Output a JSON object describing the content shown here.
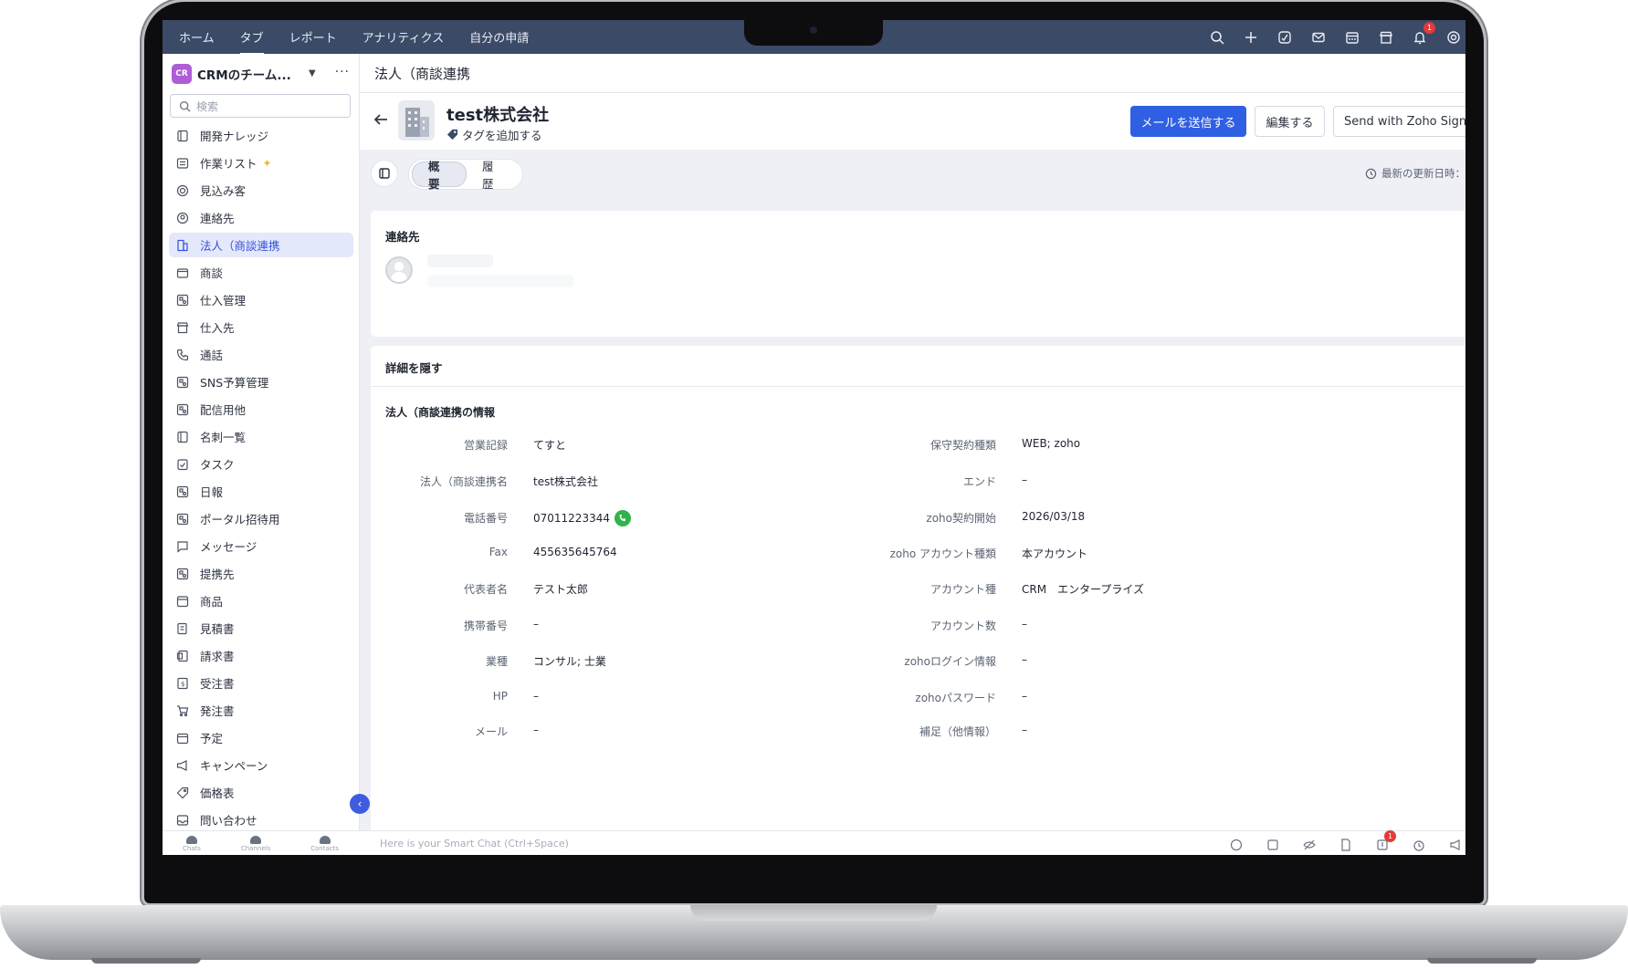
{
  "topnav": [
    "ホーム",
    "タブ",
    "レポート",
    "アナリティクス",
    "自分の申請"
  ],
  "notification_count": "1",
  "workspace": {
    "logo": "CR",
    "name": "CRMのチーム..."
  },
  "search": {
    "placeholder": "検索"
  },
  "sidebar": {
    "items": [
      {
        "label": "開発ナレッジ",
        "icon": "notebook-icon"
      },
      {
        "label": "作業リスト",
        "icon": "checklist-icon"
      },
      {
        "label": "見込み客",
        "icon": "target-icon"
      },
      {
        "label": "連絡先",
        "icon": "contact-icon"
      },
      {
        "label": "法人（商談連携",
        "icon": "building-icon"
      },
      {
        "label": "商談",
        "icon": "wallet-icon"
      },
      {
        "label": "仕入管理",
        "icon": "module-icon"
      },
      {
        "label": "仕入先",
        "icon": "store-icon"
      },
      {
        "label": "通話",
        "icon": "phone-icon"
      },
      {
        "label": "SNS予算管理",
        "icon": "module-icon"
      },
      {
        "label": "配信用他",
        "icon": "module-icon"
      },
      {
        "label": "名刺一覧",
        "icon": "notebook-icon"
      },
      {
        "label": "タスク",
        "icon": "task-icon"
      },
      {
        "label": "日報",
        "icon": "module-icon"
      },
      {
        "label": "ポータル招待用",
        "icon": "module-icon"
      },
      {
        "label": "メッセージ",
        "icon": "message-icon"
      },
      {
        "label": "提携先",
        "icon": "module-icon"
      },
      {
        "label": "商品",
        "icon": "box-icon"
      },
      {
        "label": "見積書",
        "icon": "quote-icon"
      },
      {
        "label": "請求書",
        "icon": "invoice-icon"
      },
      {
        "label": "受注書",
        "icon": "sales-order-icon"
      },
      {
        "label": "発注書",
        "icon": "cart-icon"
      },
      {
        "label": "予定",
        "icon": "calendar-icon"
      },
      {
        "label": "キャンペーン",
        "icon": "megaphone-icon"
      },
      {
        "label": "価格表",
        "icon": "tag-icon"
      },
      {
        "label": "問い合わせ",
        "icon": "inbox-icon"
      }
    ],
    "active_index": 4,
    "sparkle_index": 1
  },
  "bottom": {
    "tabs": [
      "Chats",
      "Channels",
      "Contacts"
    ],
    "smart_chat_placeholder": "Here is your Smart Chat (Ctrl+Space)",
    "badge": "1"
  },
  "page": {
    "breadcrumb": "法人（商談連携",
    "record_name": "test株式会社",
    "add_tag": "タグを追加する",
    "send_email": "メールを送信する",
    "edit": "編集する",
    "send_sign": "Send with Zoho Sign",
    "tabs": [
      "概要",
      "履歴"
    ],
    "last_updated": "最新の更新日時："
  },
  "contacts_card": {
    "title": "連絡先"
  },
  "details": {
    "hide_label": "詳細を隠す",
    "section_title": "法人（商談連携の情報",
    "left_fields": [
      {
        "label": "営業記録",
        "value": "てすと"
      },
      {
        "label": "法人（商談連携名",
        "value": "test株式会社"
      },
      {
        "label": "電話番号",
        "value": "07011223344"
      },
      {
        "label": "Fax",
        "value": "455635645764"
      },
      {
        "label": "代表者名",
        "value": "テスト太郎"
      },
      {
        "label": "携帯番号",
        "value": "–"
      },
      {
        "label": "業種",
        "value": "コンサル; 士業"
      },
      {
        "label": "HP",
        "value": "–"
      },
      {
        "label": "メール",
        "value": "–"
      }
    ],
    "right_fields": [
      {
        "label": "保守契約種類",
        "value": "WEB; zoho"
      },
      {
        "label": "エンド",
        "value": "–"
      },
      {
        "label": "zoho契約開始",
        "value": "2026/03/18"
      },
      {
        "label": "zoho アカウント種類",
        "value": "本アカウント"
      },
      {
        "label": "アカウント種",
        "value": "CRM　エンタープライズ"
      },
      {
        "label": "アカウント数",
        "value": "–"
      },
      {
        "label": "zohoログイン情報",
        "value": "–"
      },
      {
        "label": "zohoパスワード",
        "value": "–"
      },
      {
        "label": "補足（他情報）",
        "value": "–"
      }
    ]
  },
  "colors": {
    "topbar": "#3b4a66",
    "accent": "#2f5fe3",
    "active_nav_bg": "#e4e8fb"
  }
}
